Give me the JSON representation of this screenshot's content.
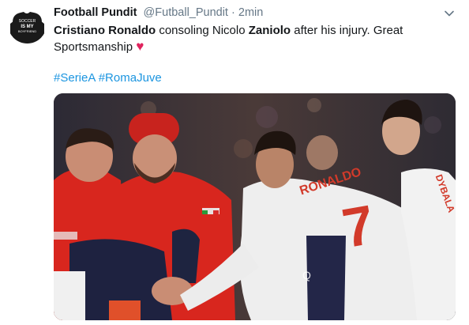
{
  "tweet": {
    "author": {
      "display_name": "Football Pundit",
      "handle": "@Futball_Pundit",
      "separator": "·",
      "time": "2min",
      "avatar_text": [
        "SOCCER",
        "IS MY",
        "BOYFRIEND"
      ]
    },
    "text": {
      "part1": "Cristiano Ronaldo",
      "part2": " consoling Nicolo ",
      "part3": "Zaniolo",
      "part4": " after his injury. Great Sportsmanship ",
      "emoji": "♥"
    },
    "hashtags": [
      "#SerieA",
      "#RomaJuve"
    ],
    "media": {
      "jersey_name": "RONALDO",
      "jersey_number": "7",
      "second_jersey_name": "DYBALA",
      "sponsor_text": "Q"
    },
    "icons": {
      "caret": "chevron-down-icon",
      "heart": "heart-emoji-icon"
    }
  },
  "colors": {
    "name": "#14171a",
    "secondary": "#657786",
    "link": "#1b95e0",
    "heart": "#e0245e",
    "medic_red": "#d8261e",
    "jersey_white": "#eeeeee",
    "number_red": "#d23a2a"
  }
}
